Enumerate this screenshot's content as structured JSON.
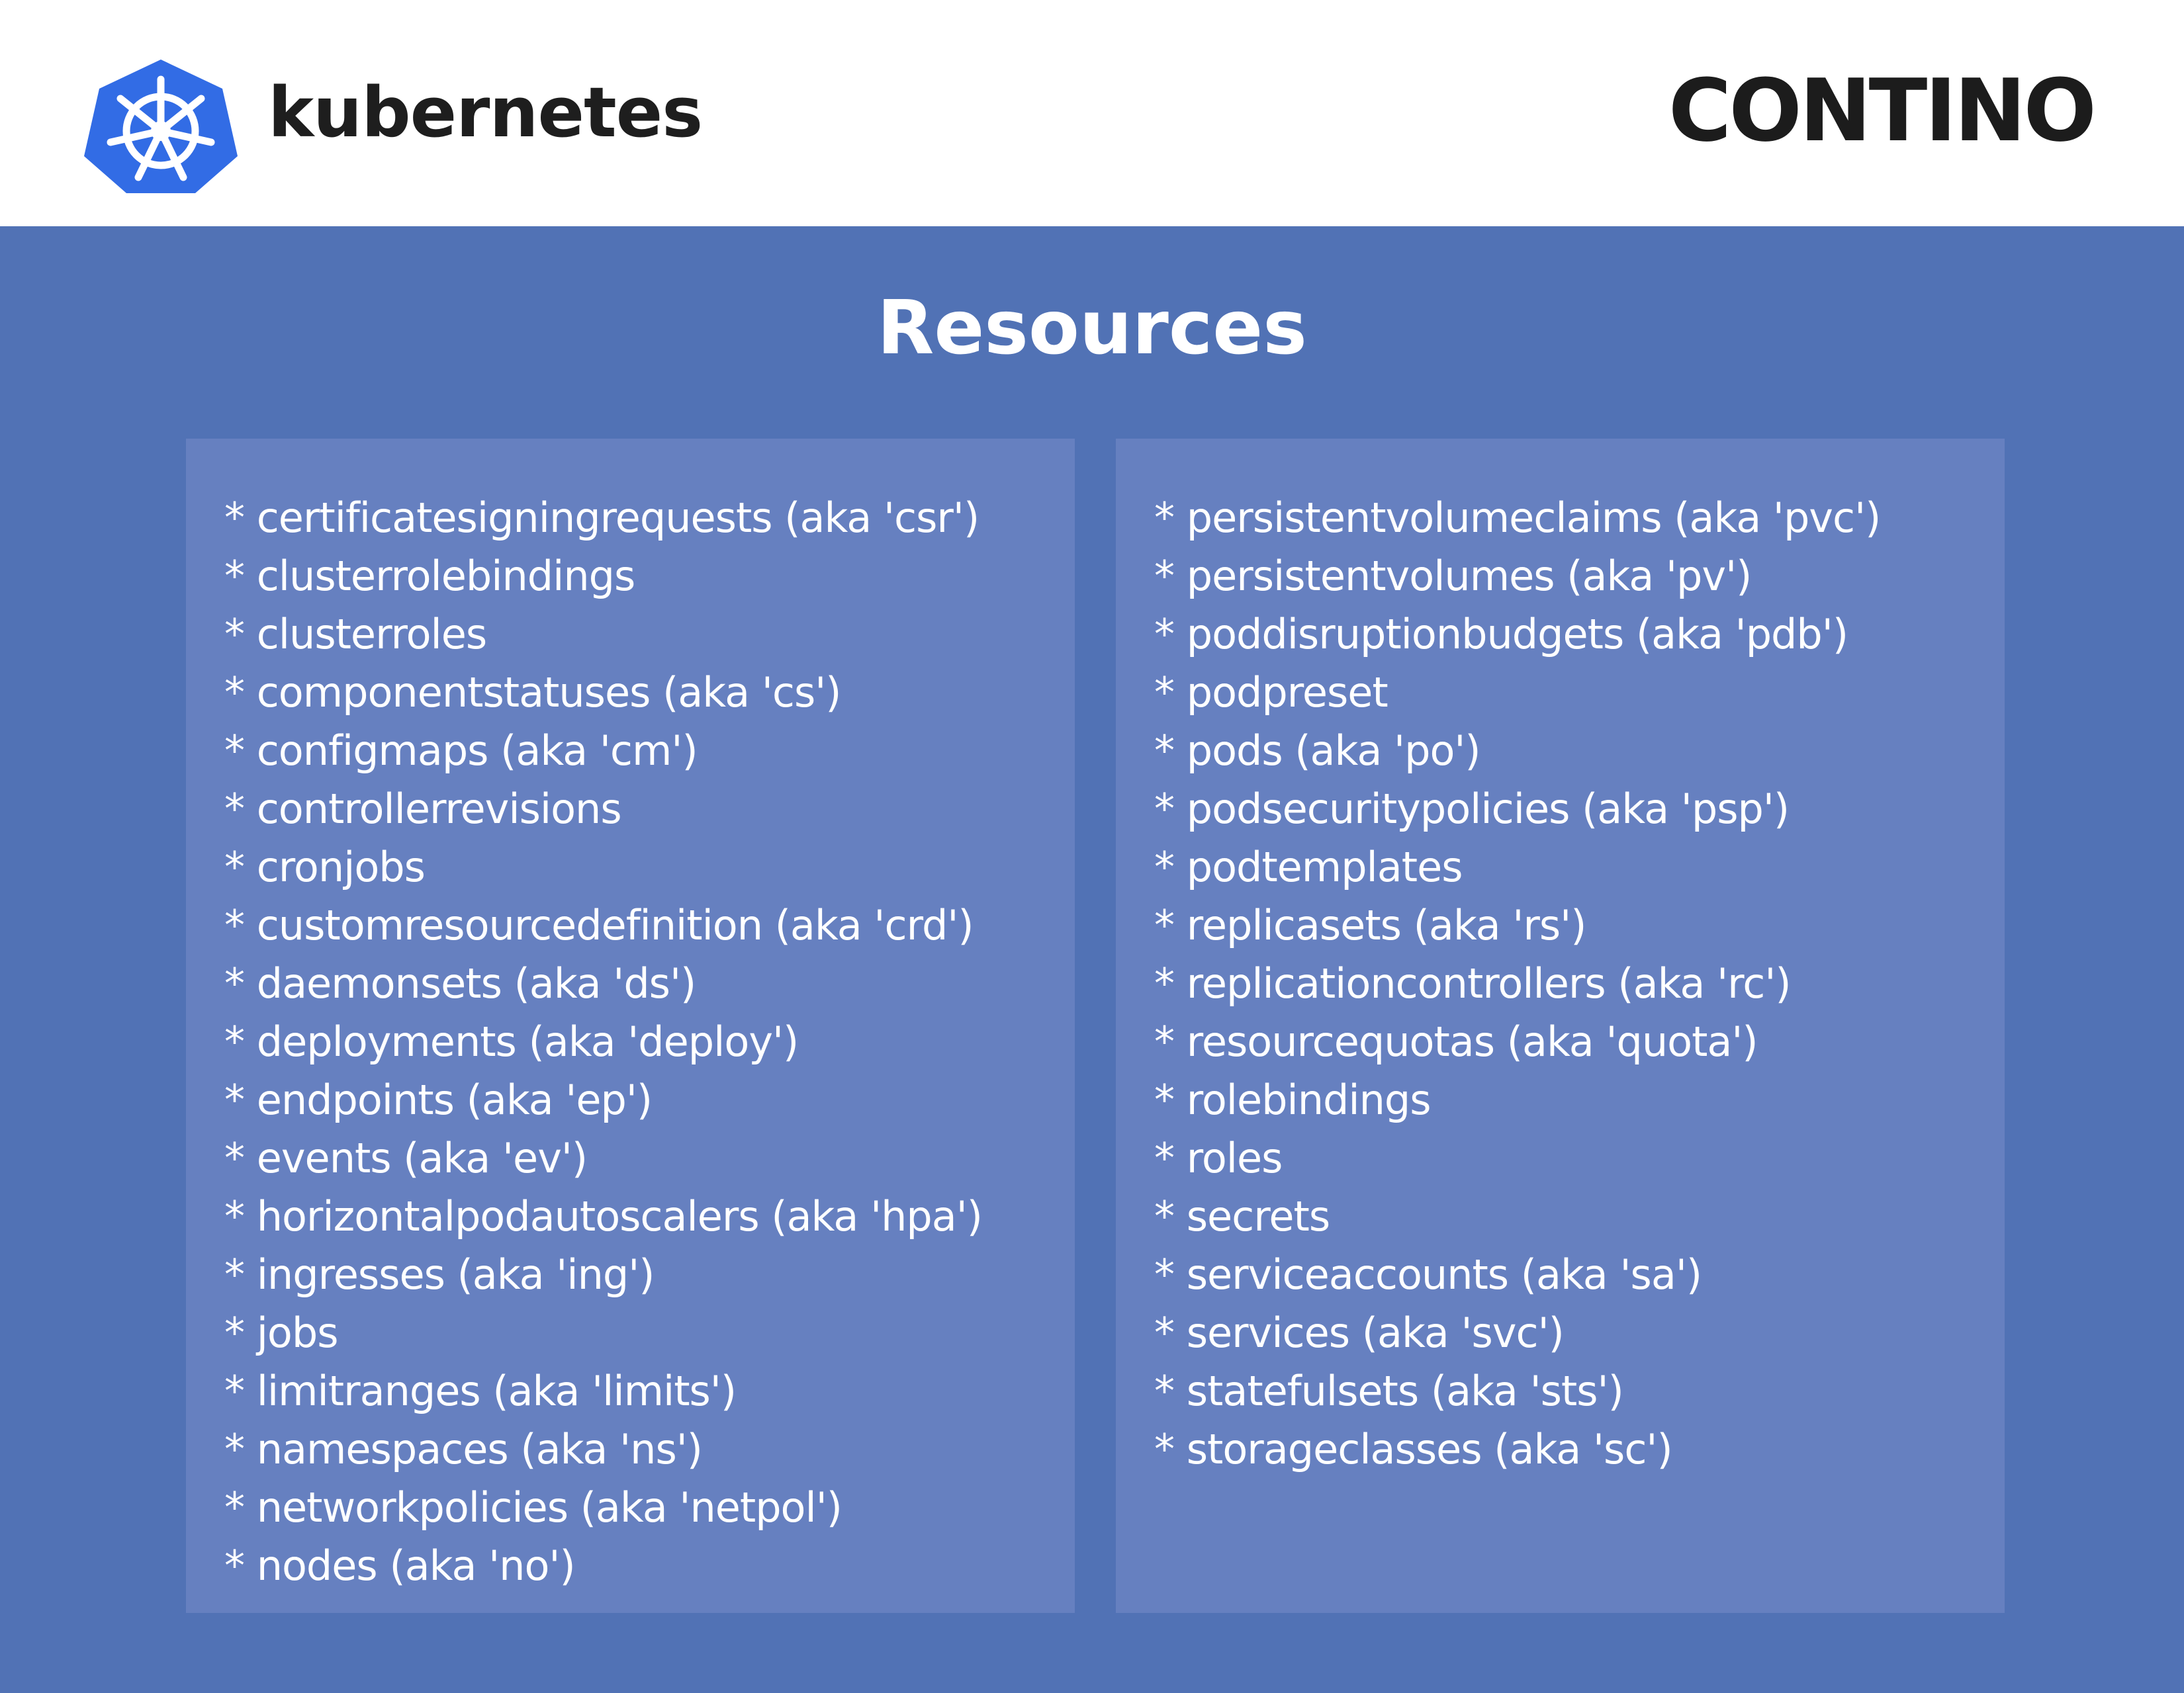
{
  "header": {
    "brand_left": "kubernetes",
    "brand_right": "CONTINO",
    "logo_icon": "kubernetes-helm-wheel-icon",
    "colors": {
      "kubernetes_blue": "#326ce5",
      "background": "#5172b5",
      "panel": "#6680c0"
    }
  },
  "title": "Resources",
  "columns": [
    {
      "items": [
        "* certificatesigningrequests (aka 'csr')",
        "* clusterrolebindings",
        "* clusterroles",
        "* componentstatuses (aka 'cs')",
        "* configmaps (aka 'cm')",
        "* controllerrevisions",
        "* cronjobs",
        "* customresourcedefinition (aka 'crd')",
        "* daemonsets (aka 'ds')",
        "* deployments (aka 'deploy')",
        "* endpoints (aka 'ep')",
        "* events (aka 'ev')",
        "* horizontalpodautoscalers (aka 'hpa')",
        "* ingresses (aka 'ing')",
        "* jobs",
        "* limitranges (aka 'limits')",
        "* namespaces (aka 'ns')",
        "* networkpolicies (aka 'netpol')",
        "* nodes (aka 'no')"
      ]
    },
    {
      "items": [
        "* persistentvolumeclaims (aka 'pvc')",
        "* persistentvolumes (aka 'pv')",
        "* poddisruptionbudgets (aka 'pdb')",
        "* podpreset",
        "* pods (aka 'po')",
        "* podsecuritypolicies (aka 'psp')",
        "* podtemplates",
        "* replicasets (aka 'rs')",
        "* replicationcontrollers (aka 'rc')",
        "* resourcequotas (aka 'quota')",
        "* rolebindings",
        "* roles",
        "* secrets",
        "* serviceaccounts (aka 'sa')",
        "* services (aka 'svc')",
        "* statefulsets (aka 'sts')",
        "* storageclasses (aka 'sc')"
      ]
    }
  ]
}
